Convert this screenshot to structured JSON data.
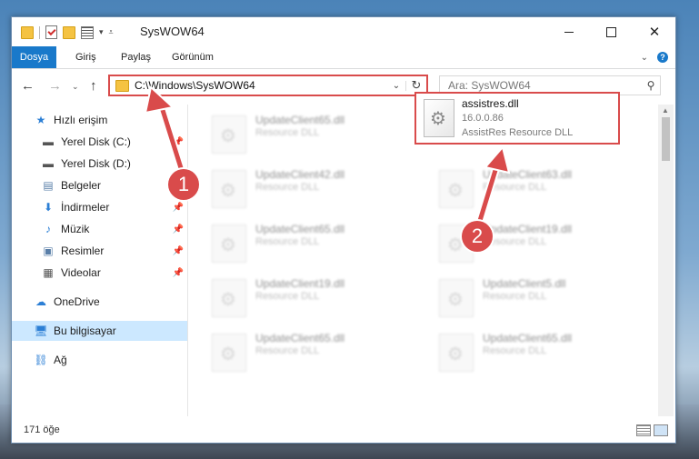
{
  "window": {
    "title": "SysWOW64"
  },
  "ribbon": {
    "tabs": [
      "Dosya",
      "Giriş",
      "Paylaş",
      "Görünüm"
    ],
    "help": "?"
  },
  "address": {
    "path": "C:\\Windows\\SysWOW64"
  },
  "search": {
    "placeholder": "Ara: SysWOW64"
  },
  "sidebar": {
    "items": [
      {
        "label": "Hızlı erişim",
        "icon": "star-icon"
      },
      {
        "label": "Yerel Disk (C:)",
        "icon": "drive-icon"
      },
      {
        "label": "Yerel Disk (D:)",
        "icon": "drive-icon"
      },
      {
        "label": "Belgeler",
        "icon": "documents-icon"
      },
      {
        "label": "İndirmeler",
        "icon": "download-icon"
      },
      {
        "label": "Müzik",
        "icon": "music-icon"
      },
      {
        "label": "Resimler",
        "icon": "pictures-icon"
      },
      {
        "label": "Videolar",
        "icon": "videos-icon"
      },
      {
        "label": "OneDrive",
        "icon": "cloud-icon"
      },
      {
        "label": "Bu bilgisayar",
        "icon": "computer-icon"
      },
      {
        "label": "Ağ",
        "icon": "network-icon"
      }
    ]
  },
  "files_left": [
    {
      "name": "UpdateClient65.dll",
      "desc": "Resource DLL"
    },
    {
      "name": "UpdateClient42.dll",
      "desc": "Resource DLL"
    },
    {
      "name": "UpdateClient65.dll",
      "desc": "Resource DLL"
    },
    {
      "name": "UpdateClient19.dll",
      "desc": "Resource DLL"
    },
    {
      "name": "UpdateClient65.dll",
      "desc": "Resource DLL"
    }
  ],
  "files_right": [
    {
      "name": "UpdateClient63.dll",
      "desc": "Resource DLL"
    },
    {
      "name": "UpdateClient19.dll",
      "desc": "Resource DLL"
    },
    {
      "name": "UpdateClient5.dll",
      "desc": "Resource DLL"
    },
    {
      "name": "UpdateClient65.dll",
      "desc": "Resource DLL"
    }
  ],
  "highlighted_file": {
    "name": "assistres.dll",
    "version": "16.0.0.86",
    "description": "AssistRes Resource DLL"
  },
  "status": {
    "count": "171 öğe"
  },
  "annotations": {
    "step1": "1",
    "step2": "2",
    "color": "#d94b4b"
  }
}
